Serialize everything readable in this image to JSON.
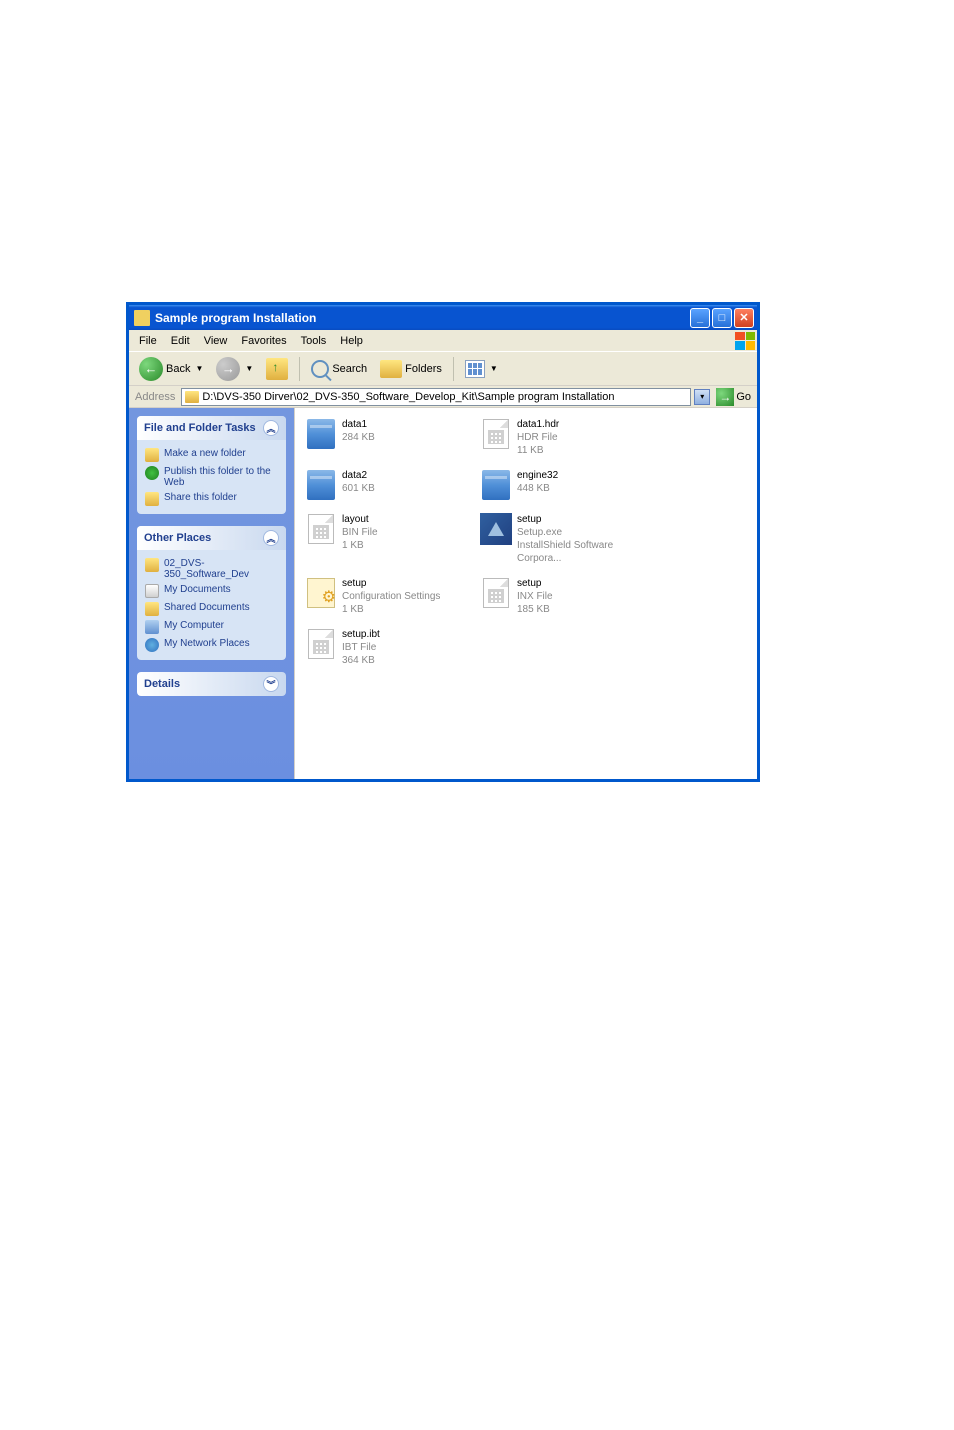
{
  "window": {
    "title": "Sample program Installation"
  },
  "menu": {
    "file": "File",
    "edit": "Edit",
    "view": "View",
    "favorites": "Favorites",
    "tools": "Tools",
    "help": "Help"
  },
  "toolbar": {
    "back": "Back",
    "search": "Search",
    "folders": "Folders"
  },
  "address": {
    "label": "Address",
    "path": "D:\\DVS-350 Dirver\\02_DVS-350_Software_Develop_Kit\\Sample program Installation",
    "go": "Go"
  },
  "sidebar": {
    "tasks_header": "File and Folder Tasks",
    "tasks": [
      {
        "label": "Make a new folder",
        "ico": "ico-newfolder"
      },
      {
        "label": "Publish this folder to the Web",
        "ico": "ico-publish"
      },
      {
        "label": "Share this folder",
        "ico": "ico-share"
      }
    ],
    "places_header": "Other Places",
    "places": [
      {
        "label": "02_DVS-350_Software_Dev",
        "ico": "ico-folder"
      },
      {
        "label": "My Documents",
        "ico": "ico-docs"
      },
      {
        "label": "Shared Documents",
        "ico": "ico-folder"
      },
      {
        "label": "My Computer",
        "ico": "ico-computer"
      },
      {
        "label": "My Network Places",
        "ico": "ico-network"
      }
    ],
    "details_header": "Details"
  },
  "files": [
    {
      "name": "data1",
      "line2": "284 KB",
      "line3": "",
      "icon": "cab"
    },
    {
      "name": "data1.hdr",
      "line2": "HDR File",
      "line3": "11 KB",
      "icon": "doc"
    },
    {
      "name": "data2",
      "line2": "601 KB",
      "line3": "",
      "icon": "cab"
    },
    {
      "name": "engine32",
      "line2": "448 KB",
      "line3": "",
      "icon": "cab"
    },
    {
      "name": "layout",
      "line2": "BIN File",
      "line3": "1 KB",
      "icon": "doc"
    },
    {
      "name": "setup",
      "line2": "Setup.exe",
      "line3": "InstallShield Software Corpora...",
      "icon": "exe"
    },
    {
      "name": "setup",
      "line2": "Configuration Settings",
      "line3": "1 KB",
      "icon": "cfg"
    },
    {
      "name": "setup",
      "line2": "INX File",
      "line3": "185 KB",
      "icon": "doc"
    },
    {
      "name": "setup.ibt",
      "line2": "IBT File",
      "line3": "364 KB",
      "icon": "doc"
    }
  ]
}
